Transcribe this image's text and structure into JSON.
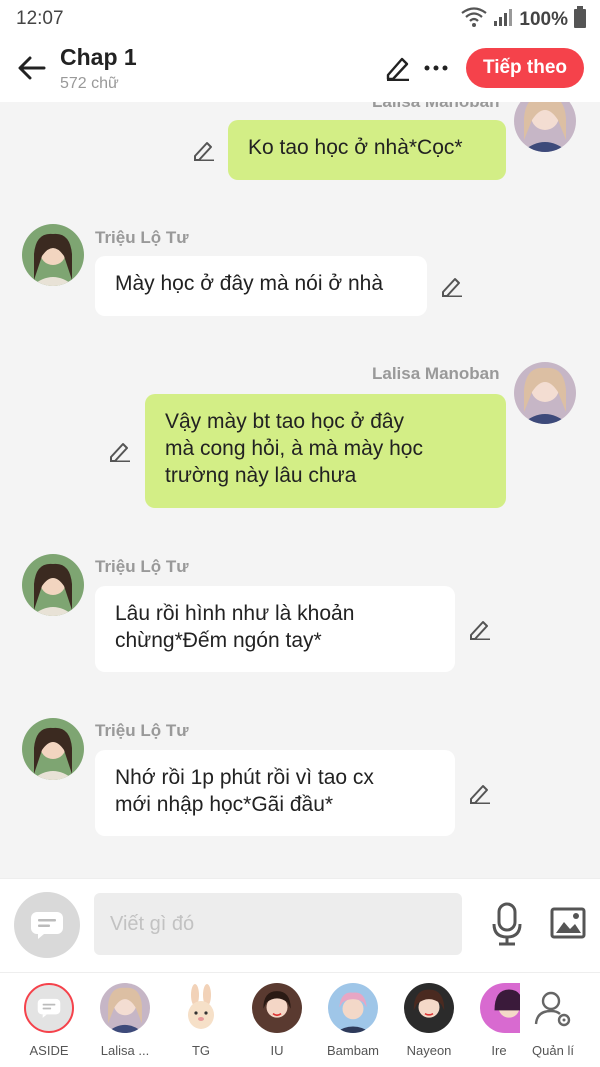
{
  "status_bar": {
    "time": "12:07",
    "battery": "100%"
  },
  "header": {
    "title": "Chap 1",
    "subtitle": "572 chữ",
    "next_label": "Tiếp theo"
  },
  "messages": [
    {
      "speaker": "Lalisa Manoban",
      "text": "Ko tao học ở nhà*Cọc*",
      "side": "right"
    },
    {
      "speaker": "Triệu Lộ Tư",
      "text": "Mày học ở đây mà nói ở nhà",
      "side": "left"
    },
    {
      "speaker": "Lalisa Manoban",
      "text": "Vậy mày bt tao học ở đây\nmà cong hỏi, à mà mày học\ntrường này lâu chưa",
      "side": "right"
    },
    {
      "speaker": "Triệu Lộ Tư",
      "text": "Lâu rồi hình như là khoản\nchừng*Đếm ngón tay*",
      "side": "left"
    },
    {
      "speaker": "Triệu Lộ Tư",
      "text": "Nhớ rồi 1p phút rồi vì tao cx\nmới nhập học*Gãi đầu*",
      "side": "left"
    }
  ],
  "composer": {
    "placeholder": "Viết gì đó"
  },
  "characters": [
    {
      "label": "ASIDE"
    },
    {
      "label": "Lalisa ..."
    },
    {
      "label": "TG"
    },
    {
      "label": "IU"
    },
    {
      "label": "Bambam"
    },
    {
      "label": "Nayeon"
    },
    {
      "label": "Ire"
    },
    {
      "label": "Quản lí"
    }
  ],
  "colors": {
    "accent": "#f5424b",
    "bubble_right": "#d3ee86",
    "bubble_left": "#ffffff",
    "background": "#f4f4f4"
  },
  "icons": [
    "wifi-icon",
    "signal-icon",
    "back-arrow-icon",
    "pencil-icon",
    "more-icon",
    "chat-bubble-icon",
    "microphone-icon",
    "image-icon",
    "bunny-icon",
    "user-settings-icon"
  ]
}
